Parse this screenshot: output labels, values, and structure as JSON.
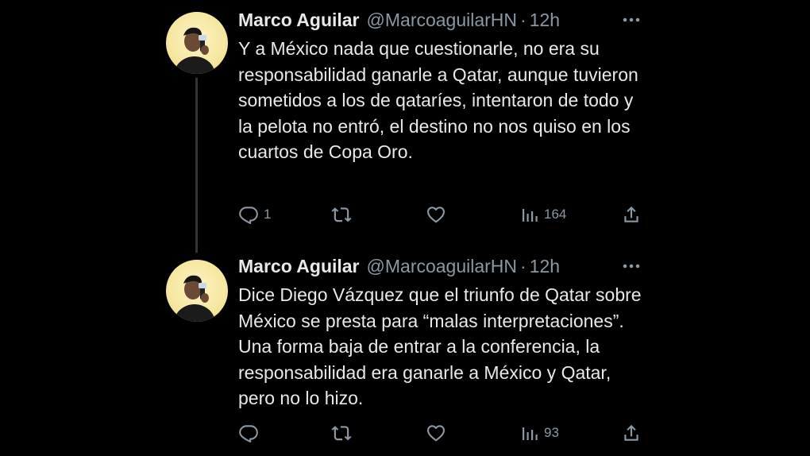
{
  "tweets": [
    {
      "author_name": "Marco Aguilar",
      "handle": "@MarcoaguilarHN",
      "separator": "·",
      "time": "12h",
      "more_icon": "more-dots-icon",
      "text": "Y a México nada que cuestionarle, no era su responsabilidad ganarle a Qatar, aunque tuvieron sometidos a los de qataríes, intentaron de todo y la pelota no entró, el destino no nos quiso en los cuartos de Copa Oro.",
      "replies": "1",
      "retweets": "",
      "likes": "",
      "views": "164"
    },
    {
      "author_name": "Marco Aguilar",
      "handle": "@MarcoaguilarHN",
      "separator": "·",
      "time": "12h",
      "more_icon": "more-dots-icon",
      "text": "Dice Diego Vázquez que el triunfo de Qatar sobre México se presta para “malas interpretaciones”. Una forma baja de entrar a la conferencia, la responsabilidad era ganarle a México y Qatar, pero no lo hizo.",
      "replies": "",
      "retweets": "",
      "likes": "",
      "views": "93"
    }
  ],
  "colors": {
    "background": "#000000",
    "text": "#e7e9ea",
    "secondary": "#8b98a5",
    "thread_line": "#333639"
  },
  "icons": [
    "reply-icon",
    "retweet-icon",
    "like-icon",
    "views-icon",
    "share-icon"
  ]
}
